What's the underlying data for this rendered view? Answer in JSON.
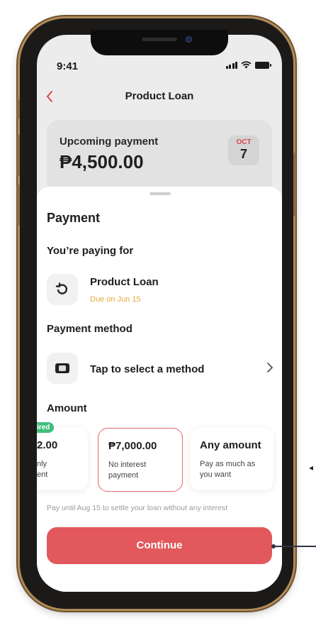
{
  "status": {
    "time": "9:41"
  },
  "header": {
    "title": "Product Loan",
    "back_icon": "chevron-left-icon"
  },
  "upcoming": {
    "label": "Upcoming payment",
    "amount": "₱4,500.00",
    "month": "OCT",
    "day": "7"
  },
  "sheet": {
    "title": "Payment",
    "paying_for_label": "You’re paying for",
    "loan": {
      "name": "Product Loan",
      "due": "Due on Jun 15"
    },
    "method_label": "Payment method",
    "method": {
      "text": "Tap to select a method"
    },
    "amount_label": "Amount",
    "badge": "ired",
    "options": [
      {
        "value": "2.00",
        "desc": "nly\nent",
        "selected": false
      },
      {
        "value": "₱7,000.00",
        "desc": "No interest payment",
        "selected": true
      },
      {
        "value": "Any amount",
        "desc": "Pay as much as you want",
        "selected": false
      }
    ],
    "hint": "Pay until Aug 15 to settle your loan without any interest",
    "continue_label": "Continue"
  },
  "colors": {
    "accent": "#e2585d",
    "due": "#e8a93a",
    "badge": "#3fbf7a"
  }
}
